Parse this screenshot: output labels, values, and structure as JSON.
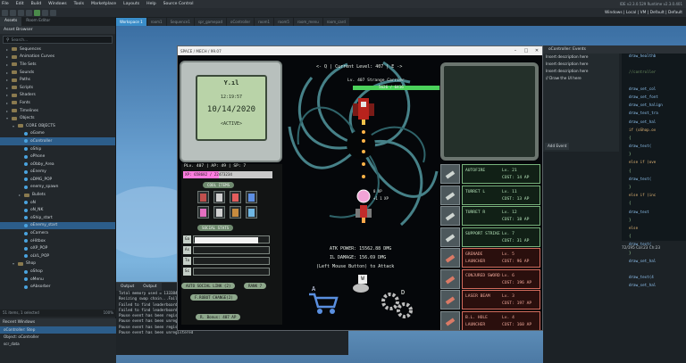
{
  "menubar": {
    "items": [
      "File",
      "Edit",
      "Build",
      "Windows",
      "Tools",
      "Marketplace",
      "Layouts",
      "Help",
      "Source Control"
    ],
    "version": "IDE v2.3.0.529 Runtime v2.3.0.401"
  },
  "toolbar": {
    "right_text": "Windows | Local | VM | Default | Default"
  },
  "assets": {
    "tabs": [
      "Assets",
      "Room Editor"
    ],
    "title": "Asset Browser",
    "search_placeholder": "Search...",
    "tree": [
      {
        "label": "Sequences",
        "kind": "folder",
        "indent": 1
      },
      {
        "label": "Animation Curves",
        "kind": "folder",
        "indent": 1
      },
      {
        "label": "Tile Sets",
        "kind": "folder",
        "indent": 1
      },
      {
        "label": "Sounds",
        "kind": "folder",
        "indent": 1
      },
      {
        "label": "Paths",
        "kind": "folder",
        "indent": 1
      },
      {
        "label": "Scripts",
        "kind": "folder",
        "indent": 1
      },
      {
        "label": "Shaders",
        "kind": "folder",
        "indent": 1
      },
      {
        "label": "Fonts",
        "kind": "folder",
        "indent": 1
      },
      {
        "label": "Timelines",
        "kind": "folder",
        "indent": 1
      },
      {
        "label": "Objects",
        "kind": "folder",
        "indent": 1,
        "open": true
      },
      {
        "label": "CORE OBJECTS",
        "kind": "folder",
        "indent": 2,
        "open": true
      },
      {
        "label": "oGame",
        "kind": "obj",
        "indent": 3
      },
      {
        "label": "oController",
        "kind": "obj",
        "indent": 3,
        "selected": true
      },
      {
        "label": "oShip",
        "kind": "obj",
        "indent": 3
      },
      {
        "label": "oPhone",
        "kind": "obj",
        "indent": 3
      },
      {
        "label": "oObby_Area",
        "kind": "obj",
        "indent": 3
      },
      {
        "label": "oEnemy",
        "kind": "obj",
        "indent": 3
      },
      {
        "label": "oDMG_POP",
        "kind": "obj",
        "indent": 3
      },
      {
        "label": "enemy_spawn",
        "kind": "obj",
        "indent": 3
      },
      {
        "label": "Bullets",
        "kind": "folder",
        "indent": 3
      },
      {
        "label": "oN",
        "kind": "obj",
        "indent": 3
      },
      {
        "label": "oN_NK",
        "kind": "obj",
        "indent": 3
      },
      {
        "label": "oShip_start",
        "kind": "obj",
        "indent": 3
      },
      {
        "label": "oEnemy_start",
        "kind": "obj",
        "indent": 3,
        "selected": true
      },
      {
        "label": "oCamera",
        "kind": "obj",
        "indent": 3
      },
      {
        "label": "oHitbox",
        "kind": "obj",
        "indent": 3
      },
      {
        "label": "oXP_POP",
        "kind": "obj",
        "indent": 3
      },
      {
        "label": "oLVL_POP",
        "kind": "obj",
        "indent": 3
      },
      {
        "label": "Shop",
        "kind": "folder",
        "indent": 2,
        "open": true
      },
      {
        "label": "oShop",
        "kind": "obj",
        "indent": 3
      },
      {
        "label": "oMenu",
        "kind": "obj",
        "indent": 3
      },
      {
        "label": "oAbsorber",
        "kind": "obj",
        "indent": 3
      }
    ],
    "status_left": "51 items, 1 selected",
    "status_right": "100%"
  },
  "recent": {
    "title": "Recent Windows",
    "items": [
      "oController: Step",
      "Object: oController",
      "scr_data"
    ]
  },
  "workspace_tabs": [
    "Workspace 1",
    "room1",
    "Sequence1",
    "spr_gamepad",
    "oController",
    "room1",
    "room5",
    "room_menu",
    "room_card"
  ],
  "game_window": {
    "title": "SPACE / MECH / 99.07",
    "pda": {
      "signal": "Y.ıl",
      "time": "12:19:57",
      "date": "10/14/2020",
      "state": "<ACTIVE>"
    },
    "stats": {
      "line": "PLv. 407 | AP: 49 | SP: 7",
      "xp": "XP: 658682 / 22473234",
      "cool_items": "COOL ITEMS",
      "social_stats": "SOCIAL STATS",
      "row_labels": [
        "Ga",
        "As",
        "To",
        "Sc"
      ],
      "buttons": [
        "AUTO SOCIAL LINK (2)",
        "RANK 7",
        "F.ROBOT CHANGE(2)",
        "R. Bonus: 407 AP"
      ]
    },
    "level_line": "<- Q | Current Level: 407 | E ->",
    "enemy": {
      "name": "Lv. 407 Strange Carrier",
      "hp": "5626 / 6416"
    },
    "attack_text": [
      "ATK POWER: 15562.88 DMG",
      "IL DAMAGE: 156.69 DMG",
      "(Left Mouse Button) to Attack"
    ],
    "drops": [
      "8 XP",
      "+1 1 XP"
    ],
    "hints": [
      "W",
      "A",
      "D"
    ],
    "upgrades": [
      {
        "name": "AUTOFIRE",
        "level": "Lv. 21",
        "cost": "COST: 14 AP",
        "red": false
      },
      {
        "name": "TURRET L",
        "level": "Lv. 11",
        "cost": "COST: 13 AP",
        "red": false
      },
      {
        "name": "TURRET R",
        "level": "Lv. 12",
        "cost": "COST: 18 AP",
        "red": false
      },
      {
        "name": "SUPPORT STRIKE",
        "level": "Lv. 7",
        "cost": "COST: 31 AP",
        "red": false
      },
      {
        "name": "GRENADE LAUNCHER",
        "level": "Lv. 5",
        "cost": "COST: 96 AP",
        "red": true
      },
      {
        "name": "CONJURED SWORD",
        "level": "Lv. 6",
        "cost": "COST: 196 AP",
        "red": true
      },
      {
        "name": "LASER BEAM",
        "level": "Lv. 3",
        "cost": "COST: 197 AP",
        "red": true
      },
      {
        "name": "B.L. HOLE LAUNCHER",
        "level": "Lv. 4",
        "cost": "COST: 160 AP",
        "red": true
      }
    ]
  },
  "events": {
    "title": "oController: Events",
    "list": [
      "Insert description here",
      "Insert description here",
      "Insert description here",
      "// Draw the UI here"
    ],
    "add_event": "Add Event",
    "code_lines": [
      {
        "t": "draw_healthb",
        "cls": "n"
      },
      {
        "t": "",
        "cls": ""
      },
      {
        "t": "//controller",
        "cls": "c"
      },
      {
        "t": "",
        "cls": ""
      },
      {
        "t": "draw_set_col",
        "cls": "n"
      },
      {
        "t": "draw_set_font",
        "cls": "n"
      },
      {
        "t": "draw_set_halign",
        "cls": "n"
      },
      {
        "t": "draw_text_tra",
        "cls": "n"
      },
      {
        "t": "draw_set_hal",
        "cls": "n"
      },
      {
        "t": "if (oShop.ov",
        "cls": "k"
      },
      {
        "t": "{",
        "cls": ""
      },
      {
        "t": "  draw_text(",
        "cls": "n"
      },
      {
        "t": "}",
        "cls": ""
      },
      {
        "t": "else if (ove",
        "cls": "k"
      },
      {
        "t": "{",
        "cls": ""
      },
      {
        "t": "  draw_text(",
        "cls": "n"
      },
      {
        "t": "}",
        "cls": ""
      },
      {
        "t": "else if (inc",
        "cls": "k"
      },
      {
        "t": "{",
        "cls": ""
      },
      {
        "t": "  draw_text",
        "cls": "n"
      },
      {
        "t": "}",
        "cls": ""
      },
      {
        "t": "else",
        "cls": "k"
      },
      {
        "t": "{",
        "cls": ""
      },
      {
        "t": "  draw_text(",
        "cls": "n"
      },
      {
        "t": "}",
        "cls": ""
      },
      {
        "t": "draw_set_hal",
        "cls": "n"
      },
      {
        "t": "",
        "cls": ""
      },
      {
        "t": "draw_text(4",
        "cls": "n"
      },
      {
        "t": "draw_set_hal",
        "cls": "n"
      }
    ],
    "cursor": "72/195 Col:23 Ch:23"
  },
  "output": {
    "tabs": [
      "Output",
      "Output"
    ],
    "lines": [
      "Total memory used = 133384",
      "Resizing swap chain...Failed t",
      "Failed to find leaderboard \"ol",
      "Failed to find leaderboard \"ol",
      "Pause event has been registe",
      "Pause event has been unregistered",
      "Pause event has been registered for this frame",
      "Pause event has been unregistered"
    ]
  }
}
